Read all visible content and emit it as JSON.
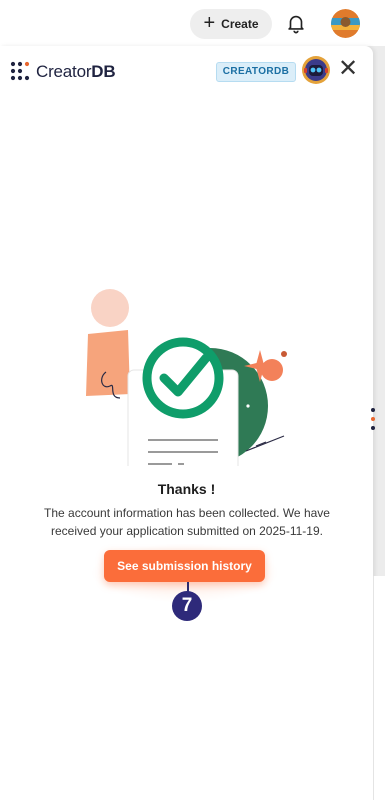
{
  "topbar": {
    "create_label": "Create",
    "create_icon": "plus-icon",
    "bell_icon": "bell-icon"
  },
  "panel": {
    "logo": {
      "word1": "Creator",
      "word2": "DB"
    },
    "badge": "CREATORDB",
    "close_icon": "close-icon"
  },
  "main": {
    "title": "Thanks !",
    "message": "The account information has been collected. We have received your application submitted on 2025-11-19.",
    "history_button": "See submission history",
    "step_marker": "7"
  },
  "colors": {
    "accent": "#fb6d3a",
    "success": "#0f9d6a",
    "dark_green": "#2f7a55",
    "marker": "#2e2a7a",
    "badge_bg": "#dbeef9",
    "badge_text": "#1b6fa3"
  }
}
